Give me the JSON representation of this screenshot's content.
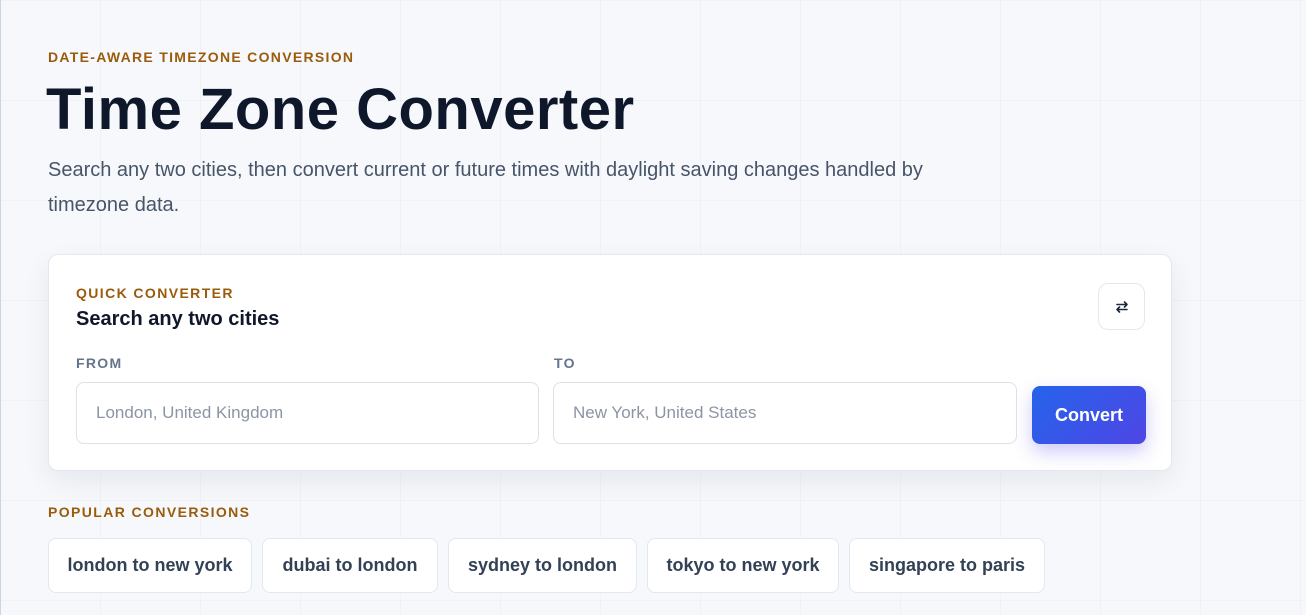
{
  "hero": {
    "eyebrow": "DATE-AWARE TIMEZONE CONVERSION",
    "title": "Time Zone Converter",
    "subtitle": "Search any two cities, then convert current or future times with daylight saving changes handled by timezone data."
  },
  "converter": {
    "eyebrow": "QUICK CONVERTER",
    "title": "Search any two cities",
    "swap_icon": "swap-arrows-icon",
    "from": {
      "label": "FROM",
      "value": "",
      "placeholder": "London, United Kingdom"
    },
    "to": {
      "label": "TO",
      "value": "",
      "placeholder": "New York, United States"
    },
    "convert_label": "Convert",
    "accent_colors": [
      "#2563eb",
      "#4f46e5"
    ]
  },
  "popular": {
    "label": "POPULAR CONVERSIONS",
    "items": [
      {
        "label": "london to new york"
      },
      {
        "label": "dubai to london"
      },
      {
        "label": "sydney to london"
      },
      {
        "label": "tokyo to new york"
      },
      {
        "label": "singapore to paris"
      }
    ]
  },
  "colors": {
    "eyebrow": "#9a5b0b",
    "heading": "#0f172a",
    "body_text": "#475569",
    "background": "#f6f8fb"
  }
}
